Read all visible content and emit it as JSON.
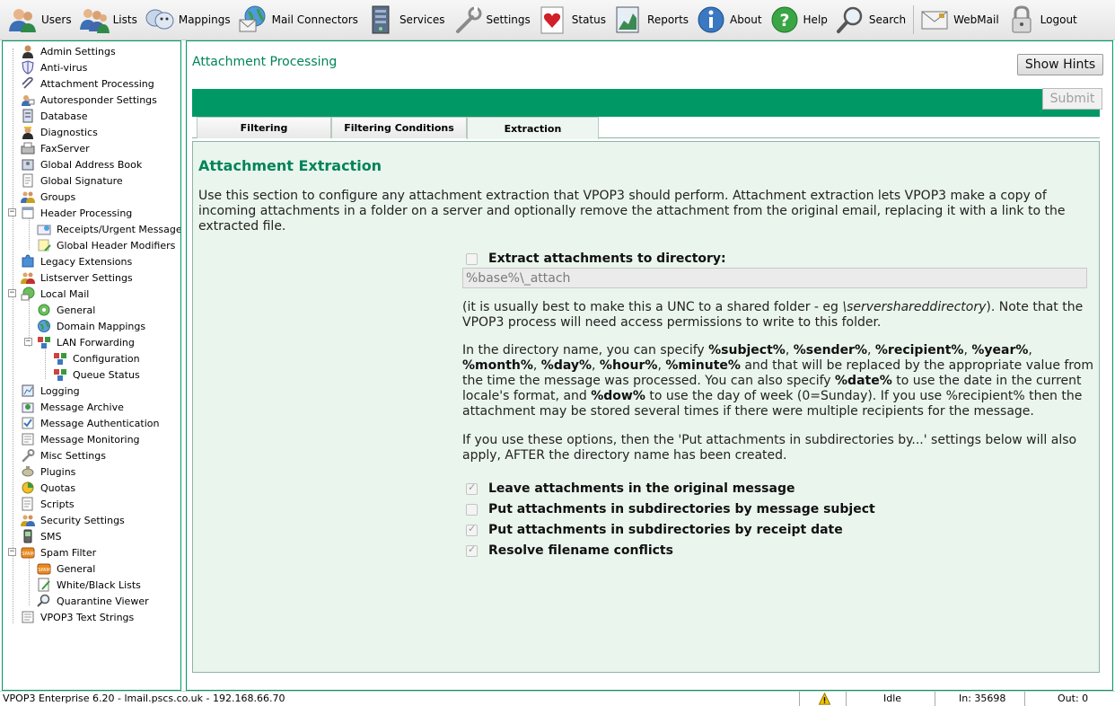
{
  "toolbar": {
    "items": [
      {
        "label": "Users",
        "icon": "users-icon"
      },
      {
        "label": "Lists",
        "icon": "lists-icon"
      },
      {
        "label": "Mappings",
        "icon": "mappings-icon"
      },
      {
        "label": "Mail Connectors",
        "icon": "mail-connectors-icon"
      },
      {
        "label": "Services",
        "icon": "services-icon"
      },
      {
        "label": "Settings",
        "icon": "settings-icon"
      },
      {
        "label": "Status",
        "icon": "status-icon"
      },
      {
        "label": "Reports",
        "icon": "reports-icon"
      },
      {
        "label": "About",
        "icon": "about-icon"
      },
      {
        "label": "Help",
        "icon": "help-icon"
      },
      {
        "label": "Search",
        "icon": "search-icon"
      },
      {
        "label": "WebMail",
        "icon": "webmail-icon"
      },
      {
        "label": "Logout",
        "icon": "logout-icon"
      }
    ]
  },
  "tree": {
    "items": [
      {
        "label": "Admin Settings",
        "icon": "admin-icon"
      },
      {
        "label": "Anti-virus",
        "icon": "shield-icon"
      },
      {
        "label": "Attachment Processing",
        "icon": "paperclip-icon"
      },
      {
        "label": "Autoresponder Settings",
        "icon": "autoresponder-icon"
      },
      {
        "label": "Database",
        "icon": "database-icon"
      },
      {
        "label": "Diagnostics",
        "icon": "diagnostics-icon"
      },
      {
        "label": "FaxServer",
        "icon": "fax-icon"
      },
      {
        "label": "Global Address Book",
        "icon": "address-book-icon"
      },
      {
        "label": "Global Signature",
        "icon": "signature-icon"
      },
      {
        "label": "Groups",
        "icon": "groups-icon"
      },
      {
        "label": "Header Processing",
        "icon": "header-icon"
      },
      {
        "label": "Receipts/Urgent Messages",
        "icon": "receipt-icon"
      },
      {
        "label": "Global Header Modifiers",
        "icon": "header-modifier-icon"
      },
      {
        "label": "Legacy Extensions",
        "icon": "puzzle-icon"
      },
      {
        "label": "Listserver Settings",
        "icon": "listserver-icon"
      },
      {
        "label": "Local Mail",
        "icon": "local-mail-icon"
      },
      {
        "label": "General",
        "icon": "general-icon"
      },
      {
        "label": "Domain Mappings",
        "icon": "globe-icon"
      },
      {
        "label": "LAN Forwarding",
        "icon": "lan-icon"
      },
      {
        "label": "Configuration",
        "icon": "configuration-icon"
      },
      {
        "label": "Queue Status",
        "icon": "queue-icon"
      },
      {
        "label": "Logging",
        "icon": "logging-icon"
      },
      {
        "label": "Message Archive",
        "icon": "archive-icon"
      },
      {
        "label": "Message Authentication",
        "icon": "authentication-icon"
      },
      {
        "label": "Message Monitoring",
        "icon": "monitoring-icon"
      },
      {
        "label": "Misc Settings",
        "icon": "wrench-icon"
      },
      {
        "label": "Plugins",
        "icon": "plugin-icon"
      },
      {
        "label": "Quotas",
        "icon": "quota-icon"
      },
      {
        "label": "Scripts",
        "icon": "script-icon"
      },
      {
        "label": "Security Settings",
        "icon": "security-icon"
      },
      {
        "label": "SMS",
        "icon": "phone-icon"
      },
      {
        "label": "Spam Filter",
        "icon": "spam-icon"
      },
      {
        "label": "General",
        "icon": "spam-general-icon"
      },
      {
        "label": "White/Black Lists",
        "icon": "list-edit-icon"
      },
      {
        "label": "Quarantine Viewer",
        "icon": "magnifier-icon"
      },
      {
        "label": "VPOP3 Text Strings",
        "icon": "text-strings-icon"
      }
    ]
  },
  "main": {
    "title": "Attachment Processing",
    "show_hints": "Show Hints",
    "submit": "Submit",
    "tabs": [
      "Filtering",
      "Filtering Conditions",
      "Extraction"
    ],
    "section_title": "Attachment Extraction",
    "intro": "Use this section to configure any attachment extraction that VPOP3 should perform. Attachment extraction lets VPOP3 make a copy of incoming attachments in a folder on a server and optionally remove the attachment from the original email, replacing it with a link to the extracted file.",
    "extract_label": "Extract attachments to directory:",
    "extract_checked": false,
    "directory_value": "%base%\\_attach",
    "unc_note": {
      "prefix": "(it is usually best to make this a UNC to a shared folder - eg ",
      "example": "\\servershareddirectory",
      "suffix": "). Note that the VPOP3 process will need access permissions to write to this folder."
    },
    "tokens": {
      "t0": "In the directory name, you can specify ",
      "subject": "%subject%",
      "c1": ", ",
      "sender": "%sender%",
      "c2": ", ",
      "recipient": "%recipient%",
      "c3": ", ",
      "year": "%year%",
      "c4": ", ",
      "month": "%month%",
      "c5": ", ",
      "day": "%day%",
      "c6": ", ",
      "hour": "%hour%",
      "c7": ", ",
      "minute": "%minute%",
      "t1": " and that will be replaced by the appropriate value from the time the message was processed. You can also specify ",
      "date": "%date%",
      "t2": " to use the date in the current locale's format, and ",
      "dow": "%dow%",
      "t3": " to use the day of week (0=Sunday). If you use %recipient% then the attachment may be stored several times if there were multiple recipients for the message."
    },
    "options_note": "If you use these options, then the 'Put attachments in subdirectories by...' settings below will also apply, AFTER the directory name has been created.",
    "options": [
      {
        "label": "Leave attachments in the original message",
        "checked": true
      },
      {
        "label": "Put attachments in subdirectories by message subject",
        "checked": false
      },
      {
        "label": "Put attachments in subdirectories by receipt date",
        "checked": true
      },
      {
        "label": "Resolve filename conflicts",
        "checked": true
      }
    ]
  },
  "status_bar": {
    "server": "VPOP3 Enterprise 6.20 - lmail.pscs.co.uk - 192.168.66.70",
    "state": "Idle",
    "in": "In: 35698",
    "out": "Out: 0",
    "warning_icon": "warning-icon"
  },
  "colors": {
    "accent": "#009966",
    "title_green": "#00845a",
    "content_bg": "#eaf5ed"
  }
}
